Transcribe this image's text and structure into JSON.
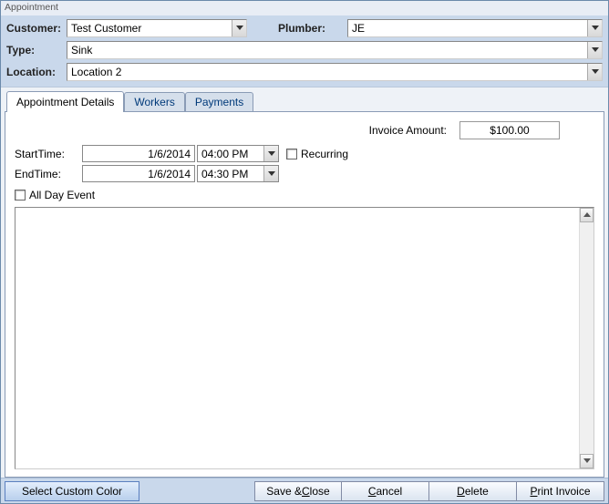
{
  "window": {
    "title": "Appointment"
  },
  "header": {
    "customer_label": "Customer:",
    "customer_value": "Test Customer",
    "plumber_label": "Plumber:",
    "plumber_value": "JE",
    "type_label": "Type:",
    "type_value": "Sink",
    "location_label": "Location:",
    "location_value": "Location 2"
  },
  "tabs": {
    "details": "Appointment Details",
    "workers": "Workers",
    "payments": "Payments",
    "active": "details"
  },
  "details": {
    "invoice_label": "Invoice Amount:",
    "invoice_value": "$100.00",
    "start_label": "StartTime:",
    "start_date": "1/6/2014",
    "start_time": "04:00 PM",
    "end_label": "EndTime:",
    "end_date": "1/6/2014",
    "end_time": "04:30 PM",
    "recurring_label": "Recurring",
    "recurring_checked": false,
    "allday_label": "All Day Event",
    "allday_checked": false,
    "notes": ""
  },
  "footer": {
    "custom_color": "Select Custom Color",
    "save_close_pre": "Save & ",
    "save_close_m": "C",
    "save_close_post": "lose",
    "cancel_m": "C",
    "cancel_post": "ancel",
    "delete_m": "D",
    "delete_post": "elete",
    "print_m": "P",
    "print_post": "rint Invoice"
  }
}
